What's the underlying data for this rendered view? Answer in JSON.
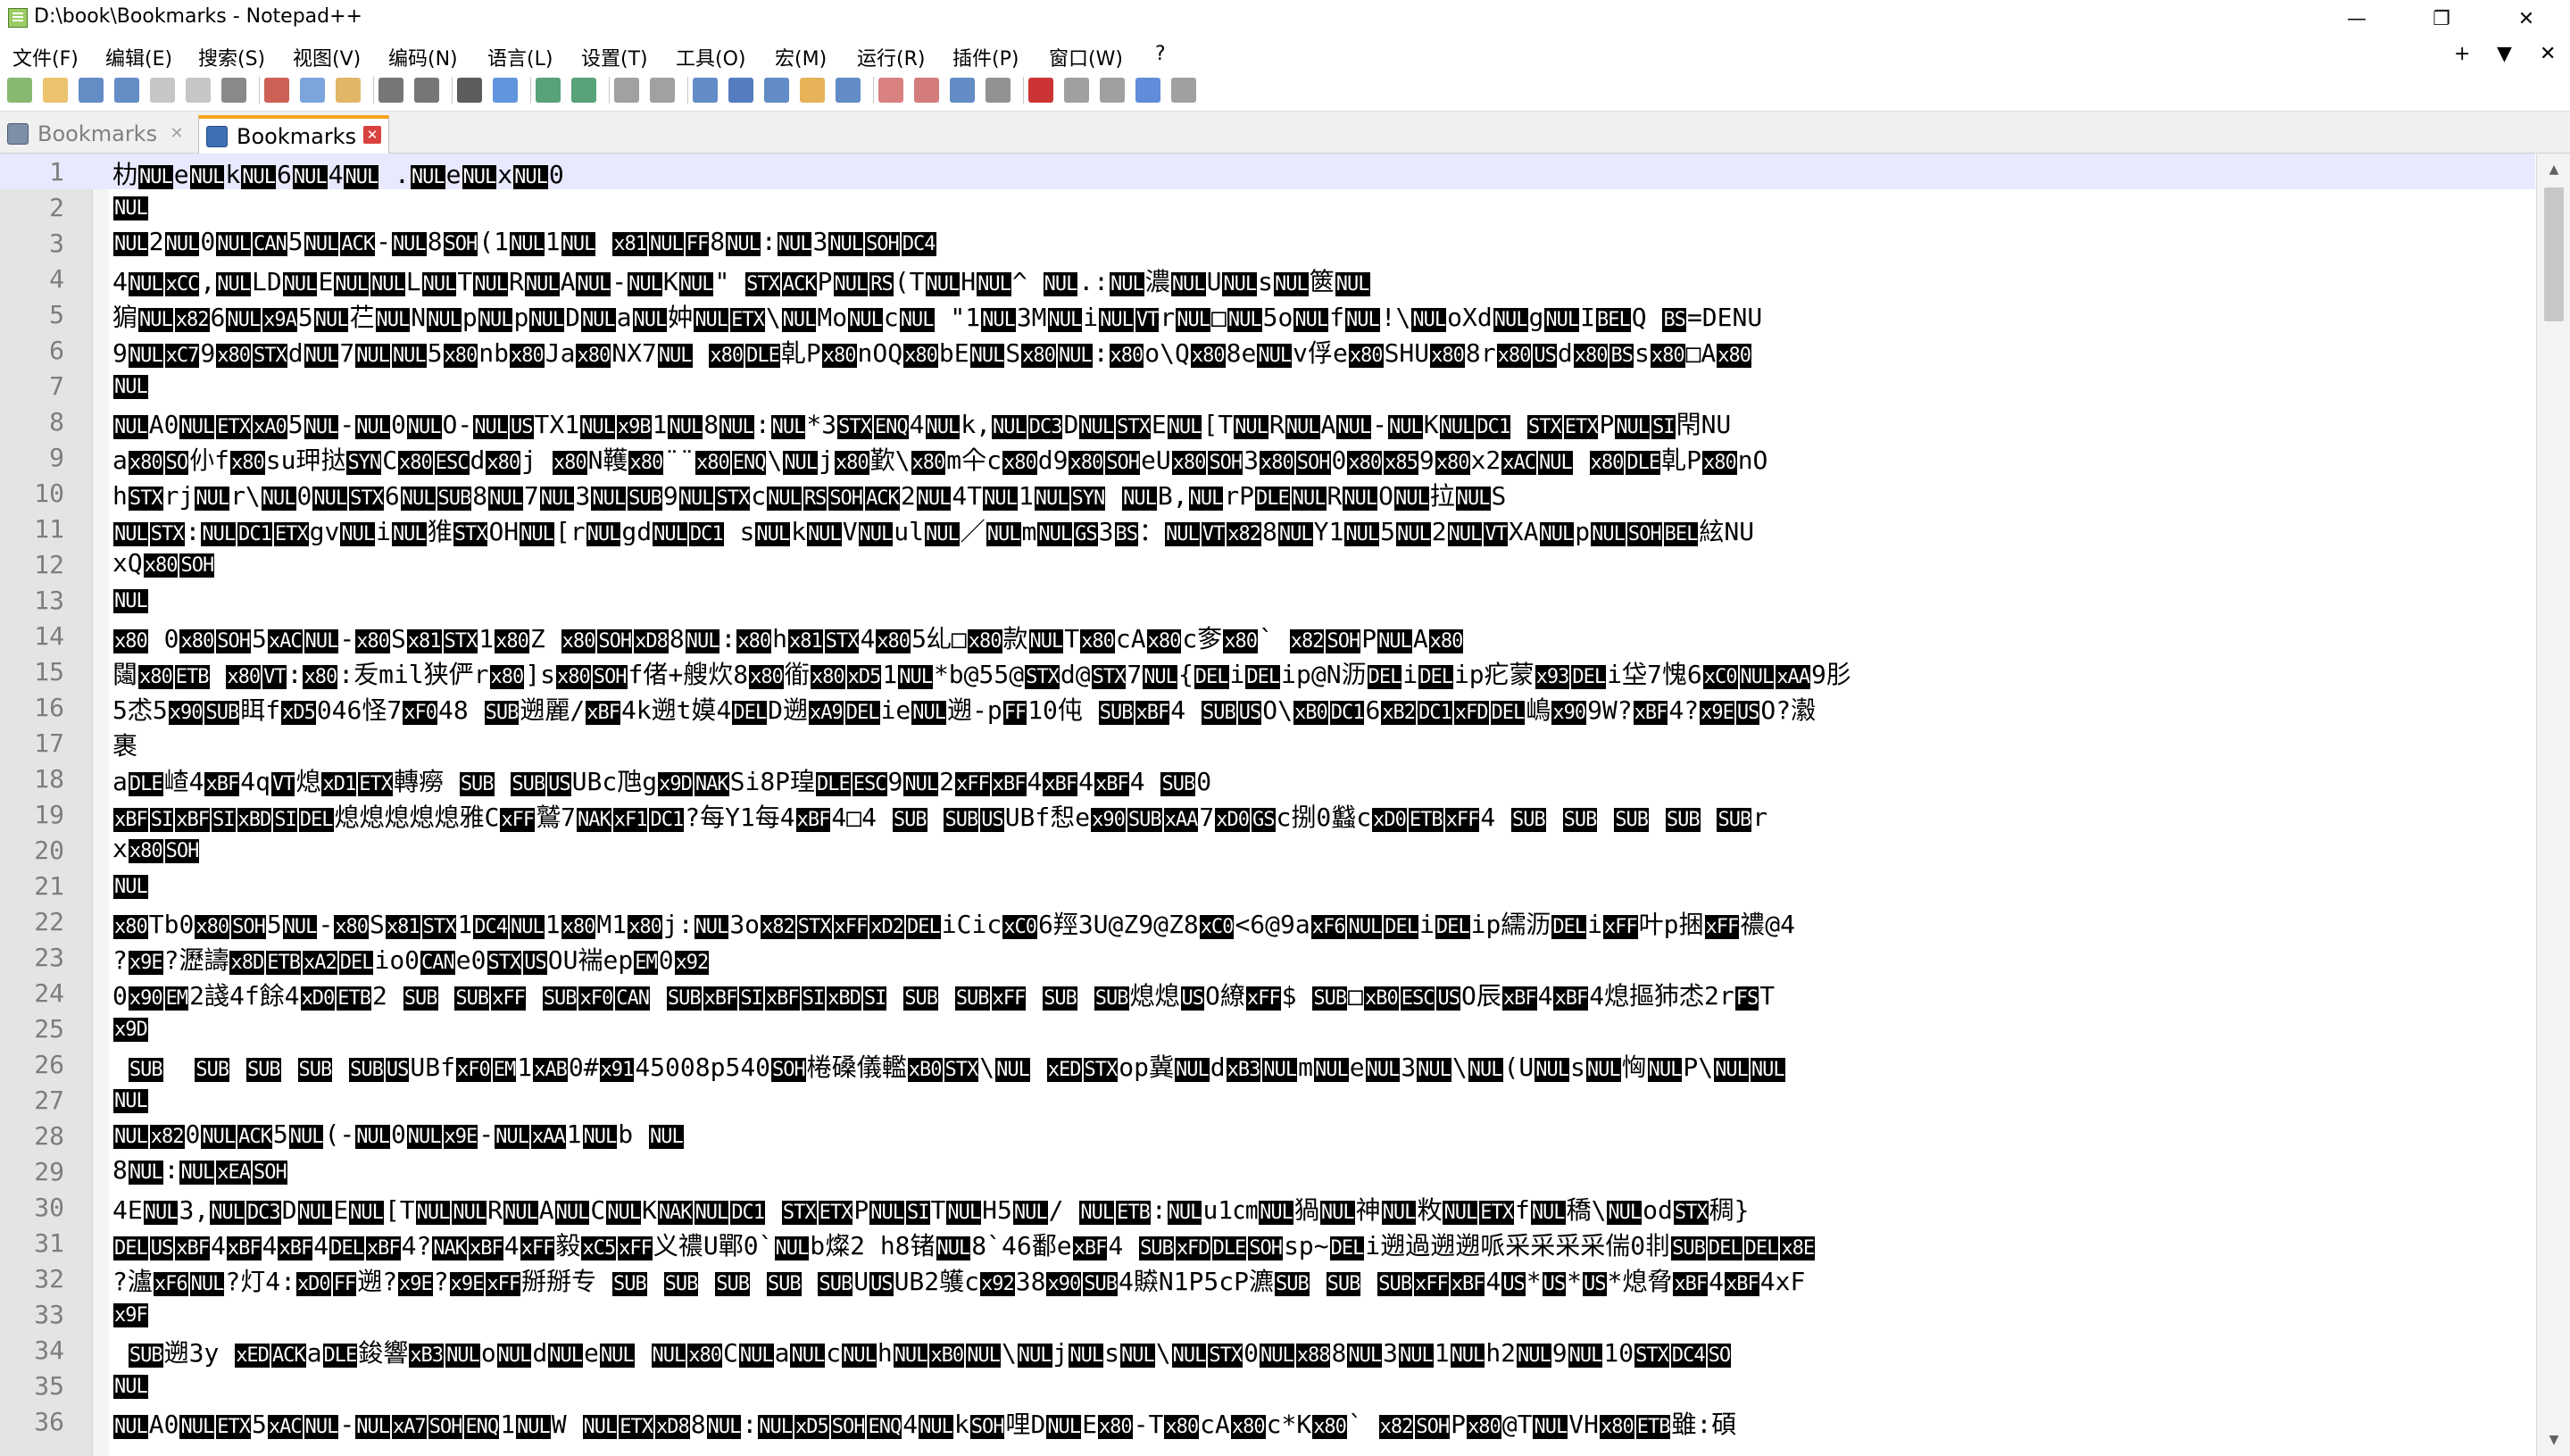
{
  "window": {
    "title": "D:\\book\\Bookmarks - Notepad++",
    "buttons": {
      "minimize": "—",
      "restore": "❐",
      "close": "✕"
    }
  },
  "menubar": {
    "items": [
      "文件(F)",
      "编辑(E)",
      "搜索(S)",
      "视图(V)",
      "编码(N)",
      "语言(L)",
      "设置(T)",
      "工具(O)",
      "宏(M)",
      "运行(R)",
      "插件(P)",
      "窗口(W)",
      "?"
    ],
    "right": [
      "+",
      "▼",
      "✕"
    ]
  },
  "toolbar": {
    "icons": [
      "new-file-icon",
      "open-file-icon",
      "save-icon",
      "save-all-icon",
      "close-icon",
      "close-all-icon",
      "print-icon",
      "cut-icon",
      "copy-icon",
      "paste-icon",
      "undo-icon",
      "redo-icon",
      "find-icon",
      "replace-icon",
      "zoom-in-icon",
      "zoom-out-icon",
      "sync-vertical-icon",
      "sync-horizontal-icon",
      "word-wrap-icon",
      "show-all-chars-icon",
      "indent-guide-icon",
      "doc-map-icon",
      "function-list-icon",
      "folder-workspace-icon",
      "monitor-icon",
      "user-defined-lang-icon",
      "clipboard-history-icon",
      "record-macro-icon",
      "stop-macro-icon",
      "play-macro-icon",
      "run-macro-multiple-icon",
      "save-macro-icon"
    ]
  },
  "tabs": [
    {
      "label": "Bookmarks",
      "active": false
    },
    {
      "label": "Bookmarks",
      "active": true
    }
  ],
  "editor": {
    "current_line": 1,
    "lines": [
      {
        "n": "1",
        "text": "朸NULeNULkNUL6NUL4NUL .NULeNULxNUL0"
      },
      {
        "n": "2",
        "text": "NUL"
      },
      {
        "n": "3",
        "text": "NUL2NUL0NULCAN5NULACK-NUL8SOH(1NUL1NUL x81NULFF8NUL:NUL3NULSOHDC4"
      },
      {
        "n": "4",
        "text": "4NULxCC,NULLDNULENULNULLNULTNULRNULANUL-NULKNUL\" STXACKPNULRS(TNULHNUL^ NUL.:NUL濃NULUNULsNUL篋NUL"
      },
      {
        "n": "5",
        "text": "猏NULx826NULx9A5NUL芢NULNNULpNULpNULDNULaNUL妕NULETX\\NULMoNULcNUL \"1NUL3MNULiNULVTrNUL□NUL5oNULfNUL!\\NULoXdNULgNULIBELQ BS=DENU"
      },
      {
        "n": "6",
        "text": "9NULxC79x80STXdNUL7NULNUL5x80nbx80Jax80NX7NUL x80DLE乹Px80nOQx80bENULSx80NUL:x80o\\Qx808eNULv俘ex80SHUx808rx80USdx80BSsx80□Ax80"
      },
      {
        "n": "7",
        "text": "NUL"
      },
      {
        "n": "8",
        "text": "NULA0NULETXxA05NUL-NUL0NULO-NULUSTX1NULx9B1NUL8NUL:NUL*3STXENQ4NULk,NULDC3DNULSTXENUL[TNULRNULANUL-NULKNULDC1 STXETXPNULSI閇NU"
      },
      {
        "n": "9",
        "text": "ax80SO仦fx80su玾挞SYNCx80ESCdx80j x80N韄x80¨¨x80ENQ\\NULjx80歏\\x80m仐cx80d9x80SOHeUx80SOH3x80SOH0x80x859x80x2xACNUL x80DLE乹Px80nO"
      },
      {
        "n": "10",
        "text": "hSTXrjNULr\\NUL0NULSTX6NULSUB8NUL7NUL3NULSUB9NULSTXcNULRSSOHACK2NUL4TNUL1NULSYN NULB,NULrPDLENULRNULONUL拉NULS"
      },
      {
        "n": "11",
        "text": "NULSTX:NULDC1ETXgvNULiNUL猚STXOHNUL[rNULgdNULDC1 sNULkNULVNULulNUL／NULmNULGS3BS：NULVTx828NULY1NUL5NUL2NULVTXANULpNULSOHBEL絃NU"
      },
      {
        "n": "12",
        "text": "xQx80SOH"
      },
      {
        "n": "13",
        "text": "NUL"
      },
      {
        "n": "14",
        "text": "x80 0x80SOH5xACNUL-x80Sx81STX1x80Z x80SOHxD88NUL:x80hx81STX4x805乣□x80款NULTx80cAx80c奓x80` x82SOHPNULAx80"
      },
      {
        "n": "15",
        "text": "闧x80ETB x80VT:x80:叐mil狭俨rx80]sx80SOHf偖+艘炊8x80衜x80xD51NUL*b@55@STXd@STX7NUL{DELiDELip@N沥DELiDELip疕蒙x93DELi垈7愧6xC0NULxAA9肜"
      },
      {
        "n": "16",
        "text": "5怸5x90SUB眲fxD5046怪7xF048 SUB遡麗/xBF4k遡t嫫4DELD遡xA9DELieNUL遡-pFF10伅 SUBxBF4 SUBUSO\\xB0DC16xB2DC1xFDDEL嶋x909W?xBF4?x9EUSO?瀫"
      },
      {
        "n": "17",
        "text": "裹"
      },
      {
        "n": "18",
        "text": "aDLE嵖4xBF4qVT熄xD1ETX轉癆 SUB SUBUSUBc虺gx9DNAKSi8P瑝DLEESC9NUL2xFFxBF4xBF4xBF4 SUB0"
      },
      {
        "n": "19",
        "text": "xBFSIxBFSIxBDSIDEL熄熄熄熄熄雅CxFF鷲7NAKxF1DC1?每Y1每4xBF4□4 SUB SUBUSUBf惒ex90SUBxAA7xD0GSc捌0蠽cxD0ETBxFF4 SUB SUB SUB SUB SUBr"
      },
      {
        "n": "20",
        "text": "xx80SOH"
      },
      {
        "n": "21",
        "text": "NUL"
      },
      {
        "n": "22",
        "text": "x80Tb0x80SOH5NUL-x80Sx81STX1DC4NUL1x80M1x80j:NUL3ox82STXxFFxD2DELiCicxC06羥3U@Z9@Z8xC0<6@9axF6NULDELiDELip繻沥DELixFF叶p捆xFF禯@4"
      },
      {
        "n": "23",
        "text": "?x9E?瀝譸x8DETBxA2DELio0CANe0STXUSOU褍epEM0x92"
      },
      {
        "n": "24",
        "text": "0x90EM2諓4f餘4xD0ETB2 SUB SUBxFF SUBxF0CAN SUBxBFSIxBFSIxBDSI SUB SUBxFF SUB SUB熄熄USO繚xFF$ SUB□xB0ESCUSO辰xBF4xBF4熄摳犻怸2rFST"
      },
      {
        "n": "25",
        "text": "x9D"
      },
      {
        "n": "26",
        "text": " SUB  SUB SUB SUB SUBUSUBfxF0EM1xAB0#x9145008p540SOH棬磉儀轞xB0STX\\NUL xEDSTXop冀NULdxB3NULmNULeNUL3NUL\\NUL(UNULsNUL恟NULP\\NULNUL"
      },
      {
        "n": "27",
        "text": "NUL"
      },
      {
        "n": "28",
        "text": "NULx820NULACK5NUL(-NUL0NULx9E-NULxAA1NULb NUL"
      },
      {
        "n": "29",
        "text": "8NUL:NULxEASOH"
      },
      {
        "n": "30",
        "text": "4ENUL3,NULDC3DNULENUL[TNULNULRNULANULCNULKNAKNULDC1 STXETXPNULSITNULH5NUL/ NULETB:NULu1㎝NUL猧NUL神NUL敉NULETXfNUL穚\\NULodSTX稠}"
      },
      {
        "n": "31",
        "text": "DELUSxBF4xBF4xBF4DELxBF4?NAKxBF4xFF毅xC5xFF义禯U鄲0`NULb燦2 h8锗NUL8`46鄱exBF4 SUBxFDDLESOHsp~DELi遡過遡遡哌采采采采偳0剕SUBDELDELx8E"
      },
      {
        "n": "32",
        "text": "?瀘xF6NUL?灯4:xD0FF遡?x9E?x9ExFF掰掰专 SUB SUB SUB SUB SUBUUSUB2鹱cx9238x90SUB4贆N1P5cP瀌SUB SUB SUBxFFxBF4US*US*US*熄脅xBF4xBF4xF"
      },
      {
        "n": "33",
        "text": "x9F"
      },
      {
        "n": "34",
        "text": " SUB遡3y xEDACKaDLE鋑響xB3NULoNULdNULeNUL NULx80CNULaNULcNULhNULxB0NUL\\NULjNULsNUL\\NULSTX0NULx888NUL3NUL1NULh2NUL9NUL10STXDC4SO"
      },
      {
        "n": "35",
        "text": "NUL"
      },
      {
        "n": "36",
        "text": "NULA0NULETX5xACNUL-NULxA7SOHENQ1NULW NULETXxD88NUL:NULxD5SOHENQ4NULkSOH哩DNULEx80-Tx80cAx80c*Kx80` x82SOHPx80@TNULVHx80ETB雖:碩"
      }
    ]
  }
}
